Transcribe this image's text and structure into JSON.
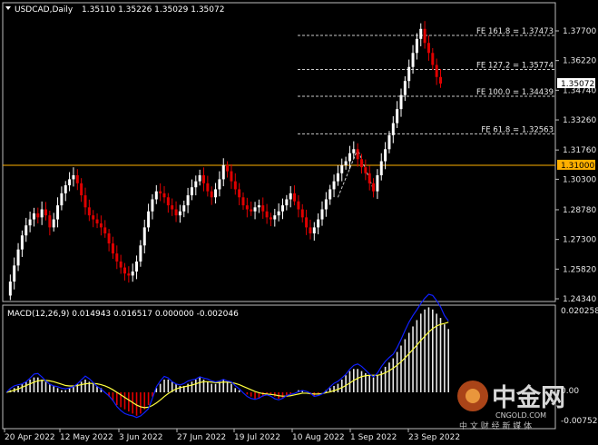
{
  "header": {
    "symbol_tf": "USDCAD,Daily",
    "ohlc": "1.35110 1.35226 1.35029 1.35072"
  },
  "fib_levels": [
    {
      "label": "FE 161.8 = 1.37473",
      "price": 1.37473
    },
    {
      "label": "FE 127.2 = 1.35774",
      "price": 1.35774
    },
    {
      "label": "FE 100.0 = 1.34439",
      "price": 1.34439
    },
    {
      "label": "FE 61.8 = 1.32563",
      "price": 1.32563
    }
  ],
  "price_axis": {
    "ticks": [
      "1.37700",
      "1.36220",
      "1.34740",
      "1.33260",
      "1.31760",
      "1.30300",
      "1.28780",
      "1.27300",
      "1.25820",
      "1.24340"
    ],
    "current_price": "1.35072",
    "hline_price": "1.31000"
  },
  "macd": {
    "title": "MACD(12,26,9) 0.014943 0.016517 0.000000 -0.002046",
    "ticks": [
      "0.020258",
      "0.00",
      "-0.007521"
    ]
  },
  "time_axis": [
    "20 Apr 2022",
    "12 May 2022",
    "3 Jun 2022",
    "27 Jun 2022",
    "19 Jul 2022",
    "10 Aug 2022",
    "1 Sep 2022",
    "23 Sep 2022"
  ],
  "watermark": {
    "text": "中金网",
    "domain": "CNGOLD.COM",
    "subtitle": "中 文 财 经 新 媒 体"
  },
  "colors": {
    "bull": "#ffffff",
    "bear": "#e00000",
    "hline": "#ffb000",
    "macd_signal": "#ffff40",
    "macd_line": "#1020ff",
    "fib": "#c8c8c8",
    "background": "#000000"
  },
  "chart_data": {
    "type": "candlestick",
    "price_range": [
      1.2434,
      1.3841
    ],
    "macd_range": [
      -0.0075,
      0.0203
    ],
    "close_path": [
      1.245,
      1.252,
      1.26,
      1.268,
      1.275,
      1.28,
      1.283,
      1.286,
      1.284,
      1.288,
      1.285,
      1.279,
      1.283,
      1.29,
      1.296,
      1.3,
      1.303,
      1.305,
      1.301,
      1.295,
      1.289,
      1.285,
      1.283,
      1.281,
      1.279,
      1.276,
      1.271,
      1.266,
      1.262,
      1.259,
      1.256,
      1.255,
      1.257,
      1.262,
      1.27,
      1.279,
      1.287,
      1.293,
      1.297,
      1.296,
      1.294,
      1.29,
      1.288,
      1.285,
      1.287,
      1.29,
      1.295,
      1.299,
      1.302,
      1.305,
      1.301,
      1.297,
      1.294,
      1.298,
      1.303,
      1.31,
      1.307,
      1.302,
      1.298,
      1.294,
      1.29,
      1.288,
      1.287,
      1.289,
      1.29,
      1.287,
      1.284,
      1.283,
      1.285,
      1.287,
      1.29,
      1.293,
      1.296,
      1.292,
      1.288,
      1.284,
      1.279,
      1.276,
      1.279,
      1.283,
      1.288,
      1.293,
      1.298,
      1.302,
      1.306,
      1.31,
      1.312,
      1.316,
      1.318,
      1.313,
      1.309,
      1.306,
      1.301,
      1.297,
      1.305,
      1.312,
      1.318,
      1.325,
      1.331,
      1.338,
      1.345,
      1.352,
      1.359,
      1.366,
      1.373,
      1.378,
      1.371,
      1.366,
      1.36,
      1.354,
      1.35072
    ],
    "macd_path": [
      0.0,
      0.0005,
      0.001,
      0.0015,
      0.002,
      0.0025,
      0.003,
      0.0035,
      0.0035,
      0.003,
      0.0025,
      0.002,
      0.0015,
      0.001,
      0.0005,
      0.0005,
      0.001,
      0.0015,
      0.002,
      0.0025,
      0.003,
      0.0025,
      0.002,
      0.0015,
      0.001,
      0.0,
      -0.001,
      -0.002,
      -0.003,
      -0.0035,
      -0.004,
      -0.0045,
      -0.005,
      -0.0055,
      -0.005,
      -0.004,
      -0.003,
      -0.001,
      0.001,
      0.002,
      0.003,
      0.003,
      0.0025,
      0.002,
      0.0015,
      0.0015,
      0.002,
      0.0025,
      0.003,
      0.0035,
      0.003,
      0.0025,
      0.002,
      0.002,
      0.0025,
      0.003,
      0.0025,
      0.002,
      0.001,
      0.0005,
      0.0,
      -0.0005,
      -0.001,
      -0.0015,
      -0.0015,
      -0.001,
      -0.0005,
      -0.0005,
      -0.001,
      -0.0015,
      -0.0015,
      -0.001,
      -0.0005,
      0.0,
      0.0005,
      0.0005,
      0.0,
      -0.0005,
      -0.001,
      -0.0005,
      0.0,
      0.0005,
      0.001,
      0.0015,
      0.002,
      0.003,
      0.004,
      0.005,
      0.0055,
      0.0055,
      0.005,
      0.0045,
      0.004,
      0.0035,
      0.004,
      0.005,
      0.006,
      0.007,
      0.008,
      0.0095,
      0.011,
      0.0125,
      0.014,
      0.0155,
      0.017,
      0.0185,
      0.0195,
      0.02,
      0.0195,
      0.0185,
      0.0175,
      0.016,
      0.0149
    ],
    "signal_path": [
      0.0,
      0.0002,
      0.0005,
      0.0008,
      0.0012,
      0.0016,
      0.002,
      0.0024,
      0.0027,
      0.0028,
      0.0028,
      0.0027,
      0.0025,
      0.0022,
      0.0019,
      0.0016,
      0.0015,
      0.0015,
      0.0016,
      0.0018,
      0.002,
      0.0021,
      0.0021,
      0.002,
      0.0018,
      0.0015,
      0.0011,
      0.0006,
      0.0,
      -0.0006,
      -0.0012,
      -0.0018,
      -0.0024,
      -0.003,
      -0.0034,
      -0.0036,
      -0.0035,
      -0.0031,
      -0.0025,
      -0.0018,
      -0.001,
      -0.0003,
      0.0003,
      0.0008,
      0.0011,
      0.0013,
      0.0015,
      0.0017,
      0.002,
      0.0023,
      0.0025,
      0.0025,
      0.0024,
      0.0023,
      0.0023,
      0.0024,
      0.0024,
      0.0023,
      0.0021,
      0.0018,
      0.0014,
      0.001,
      0.0006,
      0.0002,
      -0.0001,
      -0.0003,
      -0.0004,
      -0.0005,
      -0.0006,
      -0.0008,
      -0.0009,
      -0.0009,
      -0.0008,
      -0.0006,
      -0.0004,
      -0.0002,
      -0.0002,
      -0.0003,
      -0.0004,
      -0.0004,
      -0.0003,
      -0.0001,
      0.0001,
      0.0004,
      0.0007,
      0.0011,
      0.0016,
      0.0022,
      0.0028,
      0.0033,
      0.0037,
      0.0039,
      0.004,
      0.004,
      0.004,
      0.0042,
      0.0046,
      0.0051,
      0.0057,
      0.0064,
      0.0072,
      0.0081,
      0.0091,
      0.0101,
      0.0111,
      0.0122,
      0.0132,
      0.0142,
      0.015,
      0.0156,
      0.016,
      0.0162,
      0.0165
    ]
  }
}
